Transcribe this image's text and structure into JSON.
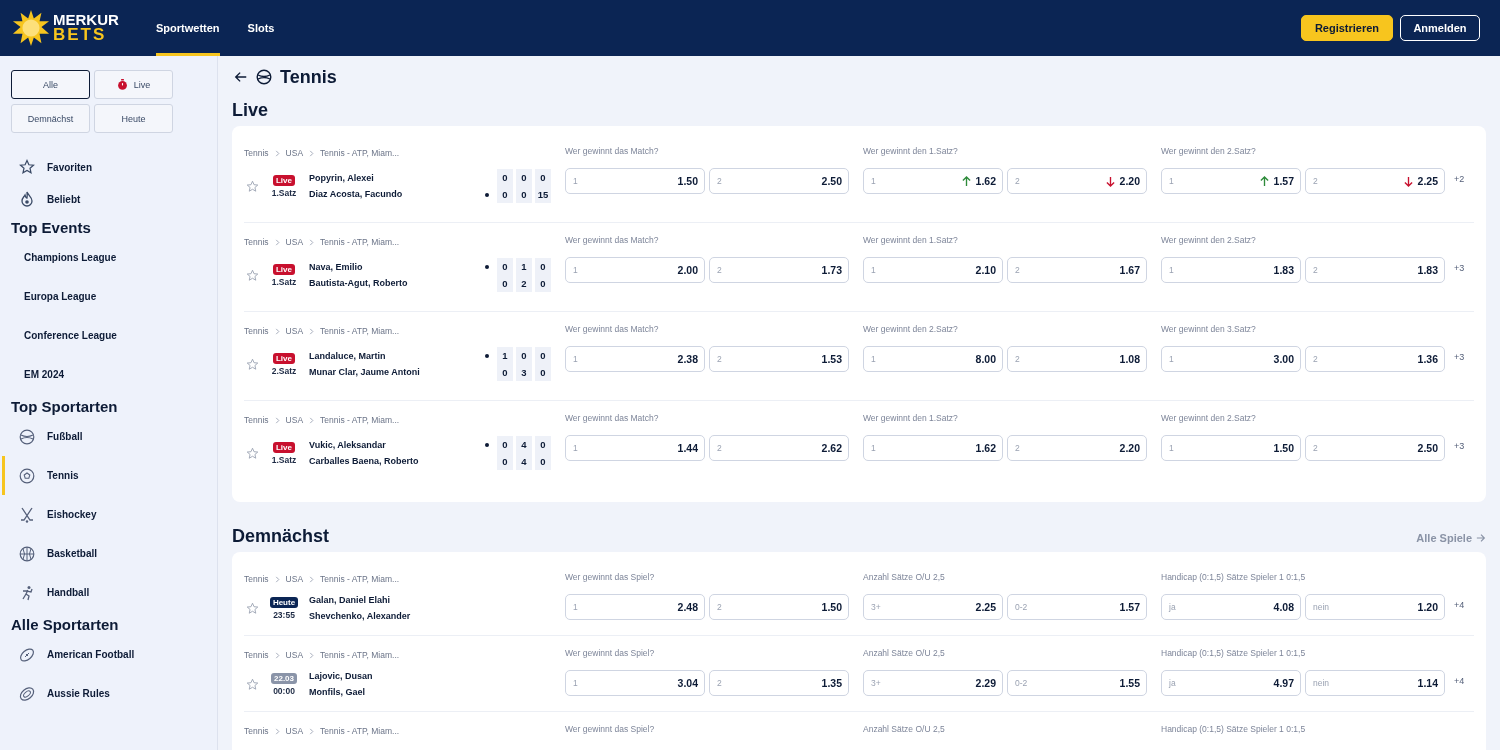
{
  "header": {
    "logo": {
      "top": "MERKUR",
      "bottom": "BETS"
    },
    "nav": [
      {
        "label": "Sportwetten",
        "selected": true
      },
      {
        "label": "Slots",
        "selected": false
      }
    ],
    "buttons": [
      {
        "label": "Registrieren",
        "kind": "primary"
      },
      {
        "label": "Anmelden",
        "kind": "outline"
      }
    ]
  },
  "sidebar": {
    "filters": [
      {
        "label": "Alle",
        "selected": true
      },
      {
        "label": "Live",
        "selected": false
      },
      {
        "label": "Demnächst",
        "selected": false
      },
      {
        "label": "Heute",
        "selected": false
      }
    ],
    "quick": [
      {
        "label": "Favoriten"
      },
      {
        "label": "Beliebt"
      }
    ],
    "sections": [
      {
        "title": "Top Events",
        "items": [
          {
            "label": "Champions League",
            "selected": false
          },
          {
            "label": "Europa League",
            "selected": false
          },
          {
            "label": "Conference League",
            "selected": false
          },
          {
            "label": "EM 2024",
            "selected": false
          }
        ]
      },
      {
        "title": "Top Sportarten",
        "items": [
          {
            "label": "Fußball",
            "selected": false
          },
          {
            "label": "Tennis",
            "selected": true
          },
          {
            "label": "Eishockey",
            "selected": false
          },
          {
            "label": "Basketball",
            "selected": false
          },
          {
            "label": "Handball",
            "selected": false
          }
        ]
      },
      {
        "title": "Alle Sportarten",
        "items": [
          {
            "label": "American Football",
            "selected": false
          },
          {
            "label": "Aussie Rules",
            "selected": false
          }
        ]
      }
    ]
  },
  "main": {
    "title": "Tennis",
    "sections": [
      {
        "title": "Live",
        "events": [
          {
            "breadcrumb": [
              "Tennis",
              "USA",
              "Tennis - ATP, Miam..."
            ],
            "status": {
              "kind": "live",
              "badge": "Live",
              "sub": "1.Satz"
            },
            "players": [
              {
                "name": "Popyrin, Alexei",
                "serving": false,
                "scores": [
                  "0",
                  "0",
                  "0"
                ]
              },
              {
                "name": "Diaz Acosta, Facundo",
                "serving": true,
                "scores": [
                  "0",
                  "0",
                  "15"
                ]
              }
            ],
            "markets": [
              {
                "title": "Wer gewinnt das Match?",
                "odds": [
                  {
                    "label": "1",
                    "value": "1.50",
                    "kind": "plain"
                  },
                  {
                    "label": "2",
                    "value": "2.50",
                    "kind": "plain"
                  }
                ]
              },
              {
                "title": "Wer gewinnt den 1.Satz?",
                "odds": [
                  {
                    "label": "1",
                    "value": "1.62",
                    "kind": "up"
                  },
                  {
                    "label": "2",
                    "value": "2.20",
                    "kind": "down"
                  }
                ]
              },
              {
                "title": "Wer gewinnt den 2.Satz?",
                "odds": [
                  {
                    "label": "1",
                    "value": "1.57",
                    "kind": "up"
                  },
                  {
                    "label": "2",
                    "value": "2.25",
                    "kind": "down"
                  }
                ]
              }
            ],
            "more": "+2"
          },
          {
            "breadcrumb": [
              "Tennis",
              "USA",
              "Tennis - ATP, Miam..."
            ],
            "status": {
              "kind": "live",
              "badge": "Live",
              "sub": "1.Satz"
            },
            "players": [
              {
                "name": "Nava, Emilio",
                "serving": true,
                "scores": [
                  "0",
                  "1",
                  "0"
                ]
              },
              {
                "name": "Bautista-Agut, Roberto",
                "serving": false,
                "scores": [
                  "0",
                  "2",
                  "0"
                ]
              }
            ],
            "markets": [
              {
                "title": "Wer gewinnt das Match?",
                "odds": [
                  {
                    "label": "1",
                    "value": "2.00",
                    "kind": "plain"
                  },
                  {
                    "label": "2",
                    "value": "1.73",
                    "kind": "plain"
                  }
                ]
              },
              {
                "title": "Wer gewinnt den 1.Satz?",
                "odds": [
                  {
                    "label": "1",
                    "value": "2.10",
                    "kind": "plain"
                  },
                  {
                    "label": "2",
                    "value": "1.67",
                    "kind": "plain"
                  }
                ]
              },
              {
                "title": "Wer gewinnt den 2.Satz?",
                "odds": [
                  {
                    "label": "1",
                    "value": "1.83",
                    "kind": "plain"
                  },
                  {
                    "label": "2",
                    "value": "1.83",
                    "kind": "plain"
                  }
                ]
              }
            ],
            "more": "+3"
          },
          {
            "breadcrumb": [
              "Tennis",
              "USA",
              "Tennis - ATP, Miam..."
            ],
            "status": {
              "kind": "live",
              "badge": "Live",
              "sub": "2.Satz"
            },
            "players": [
              {
                "name": "Landaluce, Martin",
                "serving": true,
                "scores": [
                  "1",
                  "0",
                  "0"
                ]
              },
              {
                "name": "Munar Clar, Jaume Antoni",
                "serving": false,
                "scores": [
                  "0",
                  "3",
                  "0"
                ]
              }
            ],
            "markets": [
              {
                "title": "Wer gewinnt das Match?",
                "odds": [
                  {
                    "label": "1",
                    "value": "2.38",
                    "kind": "plain"
                  },
                  {
                    "label": "2",
                    "value": "1.53",
                    "kind": "plain"
                  }
                ]
              },
              {
                "title": "Wer gewinnt den 2.Satz?",
                "odds": [
                  {
                    "label": "1",
                    "value": "8.00",
                    "kind": "plain"
                  },
                  {
                    "label": "2",
                    "value": "1.08",
                    "kind": "plain"
                  }
                ]
              },
              {
                "title": "Wer gewinnt den 3.Satz?",
                "odds": [
                  {
                    "label": "1",
                    "value": "3.00",
                    "kind": "plain"
                  },
                  {
                    "label": "2",
                    "value": "1.36",
                    "kind": "plain"
                  }
                ]
              }
            ],
            "more": "+3"
          },
          {
            "breadcrumb": [
              "Tennis",
              "USA",
              "Tennis - ATP, Miam..."
            ],
            "status": {
              "kind": "live",
              "badge": "Live",
              "sub": "1.Satz"
            },
            "players": [
              {
                "name": "Vukic, Aleksandar",
                "serving": true,
                "scores": [
                  "0",
                  "4",
                  "0"
                ]
              },
              {
                "name": "Carballes Baena, Roberto",
                "serving": false,
                "scores": [
                  "0",
                  "4",
                  "0"
                ]
              }
            ],
            "markets": [
              {
                "title": "Wer gewinnt das Match?",
                "odds": [
                  {
                    "label": "1",
                    "value": "1.44",
                    "kind": "plain"
                  },
                  {
                    "label": "2",
                    "value": "2.62",
                    "kind": "plain"
                  }
                ]
              },
              {
                "title": "Wer gewinnt den 1.Satz?",
                "odds": [
                  {
                    "label": "1",
                    "value": "1.62",
                    "kind": "plain"
                  },
                  {
                    "label": "2",
                    "value": "2.20",
                    "kind": "plain"
                  }
                ]
              },
              {
                "title": "Wer gewinnt den 2.Satz?",
                "odds": [
                  {
                    "label": "1",
                    "value": "1.50",
                    "kind": "plain"
                  },
                  {
                    "label": "2",
                    "value": "2.50",
                    "kind": "plain"
                  }
                ]
              }
            ],
            "more": "+3"
          }
        ]
      },
      {
        "title": "Demnächst",
        "link": "Alle Spiele",
        "events": [
          {
            "breadcrumb": [
              "Tennis",
              "USA",
              "Tennis - ATP, Miam..."
            ],
            "status": {
              "kind": "today",
              "badge": "Heute",
              "sub": "23:55"
            },
            "players": [
              {
                "name": "Galan, Daniel Elahi"
              },
              {
                "name": "Shevchenko, Alexander"
              }
            ],
            "markets": [
              {
                "title": "Wer gewinnt das Spiel?",
                "odds": [
                  {
                    "label": "1",
                    "value": "2.48",
                    "kind": "plain"
                  },
                  {
                    "label": "2",
                    "value": "1.50",
                    "kind": "plain"
                  }
                ]
              },
              {
                "title": "Anzahl Sätze O/U 2,5",
                "odds": [
                  {
                    "label": "3+",
                    "value": "2.25",
                    "kind": "plain"
                  },
                  {
                    "label": "0-2",
                    "value": "1.57",
                    "kind": "plain"
                  }
                ]
              },
              {
                "title": "Handicap (0:1,5) Sätze Spieler 1 0:1,5",
                "odds": [
                  {
                    "label": "ja",
                    "value": "4.08",
                    "kind": "plain"
                  },
                  {
                    "label": "nein",
                    "value": "1.20",
                    "kind": "plain"
                  }
                ]
              }
            ],
            "more": "+4"
          },
          {
            "breadcrumb": [
              "Tennis",
              "USA",
              "Tennis - ATP, Miam..."
            ],
            "status": {
              "kind": "date",
              "badge": "22.03",
              "sub": "00:00"
            },
            "players": [
              {
                "name": "Lajovic, Dusan"
              },
              {
                "name": "Monfils, Gael"
              }
            ],
            "markets": [
              {
                "title": "Wer gewinnt das Spiel?",
                "odds": [
                  {
                    "label": "1",
                    "value": "3.04",
                    "kind": "plain"
                  },
                  {
                    "label": "2",
                    "value": "1.35",
                    "kind": "plain"
                  }
                ]
              },
              {
                "title": "Anzahl Sätze O/U 2,5",
                "odds": [
                  {
                    "label": "3+",
                    "value": "2.29",
                    "kind": "plain"
                  },
                  {
                    "label": "0-2",
                    "value": "1.55",
                    "kind": "plain"
                  }
                ]
              },
              {
                "title": "Handicap (0:1,5) Sätze Spieler 1 0:1,5",
                "odds": [
                  {
                    "label": "ja",
                    "value": "4.97",
                    "kind": "plain"
                  },
                  {
                    "label": "nein",
                    "value": "1.14",
                    "kind": "plain"
                  }
                ]
              }
            ],
            "more": "+4"
          },
          {
            "breadcrumb": [
              "Tennis",
              "USA",
              "Tennis - ATP, Miam..."
            ],
            "markets": [
              {
                "title": "Wer gewinnt das Spiel?"
              },
              {
                "title": "Anzahl Sätze O/U 2,5"
              },
              {
                "title": "Handicap (0:1,5) Sätze Spieler 1 0:1,5"
              }
            ]
          }
        ]
      }
    ]
  }
}
